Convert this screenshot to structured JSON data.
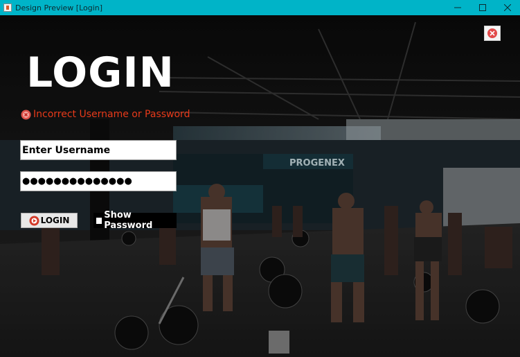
{
  "window": {
    "title": "Design Preview [Login]",
    "controls": [
      "minimize",
      "maximize",
      "close"
    ]
  },
  "heading": "LOGIN",
  "error": {
    "icon": "error-x-icon",
    "message": "Incorrect Username or Password",
    "color": "#e83a1a"
  },
  "username": {
    "value": "Enter Username"
  },
  "password": {
    "value": "●●●●●●●●●●●●●●"
  },
  "login_button": {
    "icon": "login-icon",
    "label": "LOGIN"
  },
  "show_password": {
    "label": "Show Password",
    "checked": false
  },
  "background": {
    "gym_sign": "PROGENEX"
  },
  "colors": {
    "titlebar": "#00b4c8",
    "heading": "#ffffff",
    "error": "#e83a1a"
  }
}
